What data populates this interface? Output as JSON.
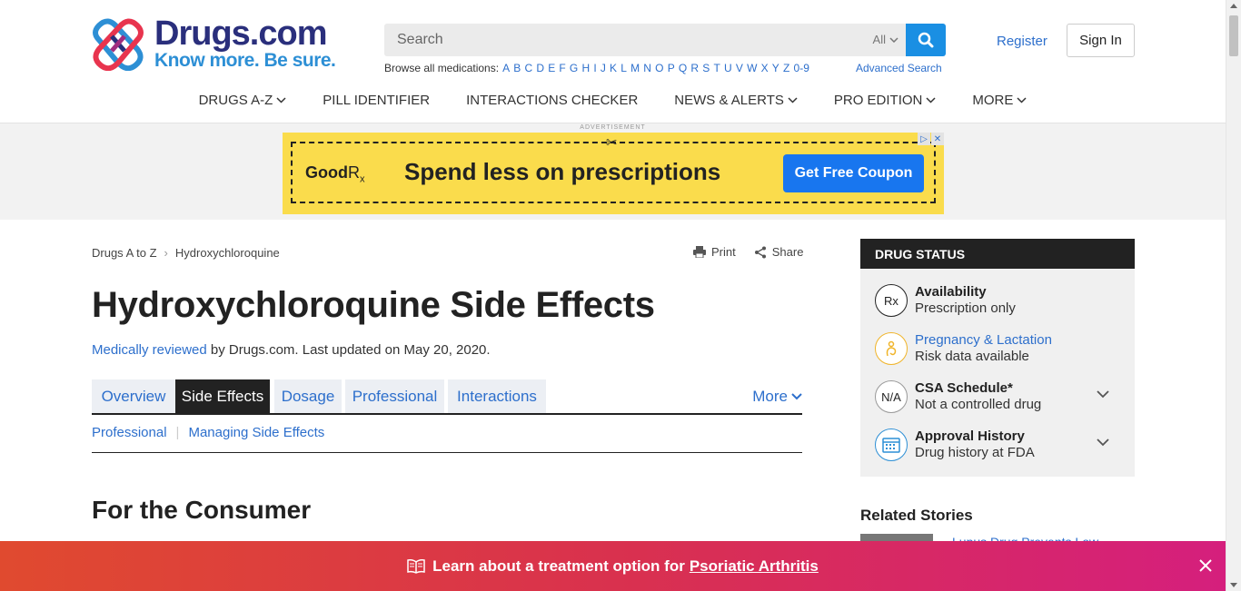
{
  "header": {
    "logo_name": "Drugs.com",
    "logo_tagline": "Know more. Be sure.",
    "search_placeholder": "Search",
    "search_scope": "All",
    "browse_label": "Browse all medications:",
    "browse_letters": [
      "A",
      "B",
      "C",
      "D",
      "E",
      "F",
      "G",
      "H",
      "I",
      "J",
      "K",
      "L",
      "M",
      "N",
      "O",
      "P",
      "Q",
      "R",
      "S",
      "T",
      "U",
      "V",
      "W",
      "X",
      "Y",
      "Z",
      "0-9"
    ],
    "advanced_search": "Advanced Search",
    "register": "Register",
    "sign_in": "Sign In"
  },
  "nav": {
    "items": [
      {
        "label": "Drugs A-Z",
        "has_menu": true
      },
      {
        "label": "Pill Identifier",
        "has_menu": false
      },
      {
        "label": "Interactions Checker",
        "has_menu": false
      },
      {
        "label": "News & Alerts",
        "has_menu": true
      },
      {
        "label": "Pro Edition",
        "has_menu": true
      },
      {
        "label": "More",
        "has_menu": true
      }
    ]
  },
  "ad": {
    "label": "ADVERTISEMENT",
    "brand": "GoodRx",
    "headline": "Spend less on prescriptions",
    "cta": "Get Free Coupon",
    "bg_color": "#fadc4c",
    "cta_color": "#1876ef"
  },
  "breadcrumb": {
    "root": "Drugs A to Z",
    "current": "Hydroxychloroquine"
  },
  "tools": {
    "print": "Print",
    "share": "Share"
  },
  "page": {
    "title": "Hydroxychloroquine Side Effects",
    "reviewed_link": "Medically reviewed",
    "reviewed_rest": " by Drugs.com. Last updated on May 20, 2020.",
    "section_title": "For the Consumer"
  },
  "tabs": {
    "items": [
      "Overview",
      "Side Effects",
      "Dosage",
      "Professional",
      "Interactions"
    ],
    "active_index": 1,
    "more": "More"
  },
  "subnav": {
    "items": [
      "Professional",
      "Managing Side Effects"
    ]
  },
  "drug_status": {
    "header": "DRUG STATUS",
    "availability_icon": "Rx",
    "availability_title": "Availability",
    "availability_sub": "Prescription only",
    "pregnancy_title": "Pregnancy & Lactation",
    "pregnancy_sub": "Risk data available",
    "csa_icon": "N/A",
    "csa_title": "CSA Schedule*",
    "csa_sub": "Not a controlled drug",
    "approval_title": "Approval History",
    "approval_sub": "Drug history at FDA"
  },
  "related": {
    "title": "Related Stories",
    "first_story": "Lupus Drug Prevents Low..."
  },
  "promo": {
    "text": "Learn about a treatment option for",
    "link": "Psoriatic Arthritis"
  },
  "colors": {
    "brand_navy": "#2a2f7c",
    "brand_blue": "#2d8fd5",
    "link": "#2d6fcc",
    "search_button": "#1a8fe3"
  }
}
